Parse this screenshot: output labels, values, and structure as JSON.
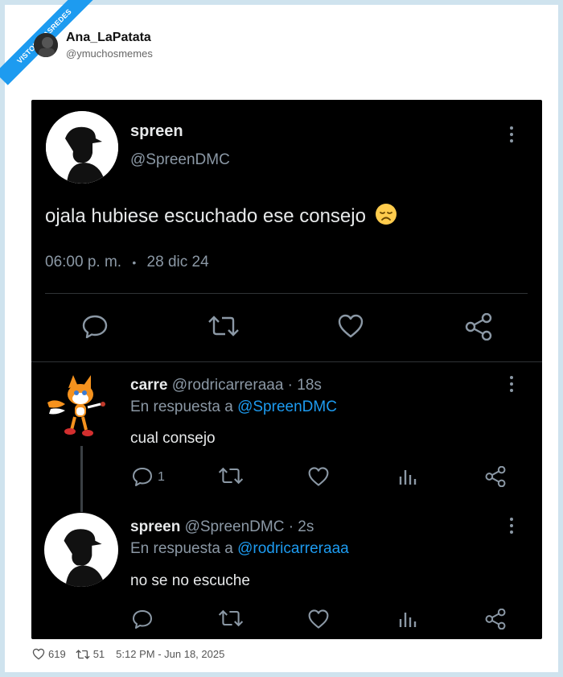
{
  "watermark": "VISTOENLASREDES",
  "poster": {
    "name": "Ana_LaPatata",
    "handle": "@ymuchosmemes"
  },
  "main_tweet": {
    "name": "spreen",
    "handle": "@SpreenDMC",
    "text": "ojala hubiese escuchado ese consejo",
    "emoji": "disappointed-face",
    "time": "06:00 p. m.",
    "dot": "•",
    "date": "28 dic 24"
  },
  "replies": [
    {
      "name": "carre",
      "handle_time": "@rodricarreraaa · 18s",
      "reply_prefix": "En respuesta a",
      "reply_to": "@SpreenDMC",
      "text": "cual consejo",
      "reply_count": "1"
    },
    {
      "name": "spreen",
      "handle_time": "@SpreenDMC · 2s",
      "reply_prefix": "En respuesta a",
      "reply_to": "@rodricarreraaa",
      "text": "no se no escuche",
      "reply_count": ""
    }
  ],
  "footer": {
    "likes": "619",
    "retweets": "51",
    "timestamp": "5:12 PM - Jun 18, 2025"
  },
  "colors": {
    "accent": "#1d9bf0",
    "background": "#000000",
    "muted": "#8b98a5"
  }
}
